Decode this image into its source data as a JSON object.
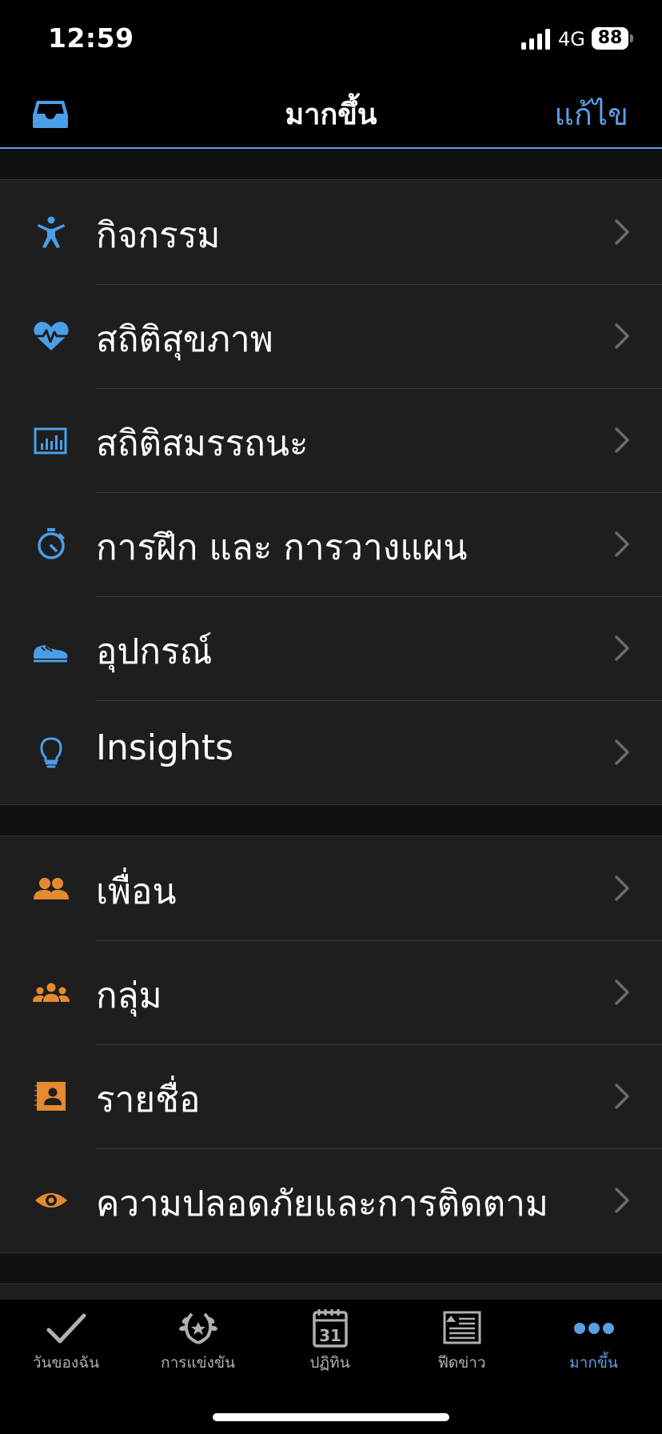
{
  "status_bar": {
    "time": "12:59",
    "network": "4G",
    "battery": "88"
  },
  "nav": {
    "title": "มากขึ้น",
    "edit_label": "แก้ไข",
    "inbox_icon": "inbox-icon"
  },
  "sections": [
    {
      "items": [
        {
          "label": "กิจกรรม",
          "icon": "activity-person-icon",
          "color": "#4a9fe8"
        },
        {
          "label": "สถิติสุขภาพ",
          "icon": "heart-rate-icon",
          "color": "#4a9fe8"
        },
        {
          "label": "สถิติสมรรถนะ",
          "icon": "performance-chart-icon",
          "color": "#4a9fe8"
        },
        {
          "label": "การฝึก และ การวางแผน",
          "icon": "stopwatch-icon",
          "color": "#4a9fe8"
        },
        {
          "label": "อุปกรณ์",
          "icon": "shoe-icon",
          "color": "#4a9fe8"
        },
        {
          "label": "Insights",
          "icon": "lightbulb-icon",
          "color": "#4a9fe8"
        }
      ]
    },
    {
      "items": [
        {
          "label": "เพื่อน",
          "icon": "friends-icon",
          "color": "#e38b2e"
        },
        {
          "label": "กลุ่ม",
          "icon": "groups-icon",
          "color": "#e38b2e"
        },
        {
          "label": "รายชื่อ",
          "icon": "contacts-book-icon",
          "color": "#e38b2e"
        },
        {
          "label": "ความปลอดภัยและการติดตาม",
          "icon": "eye-icon",
          "color": "#e38b2e"
        }
      ]
    }
  ],
  "tabs": [
    {
      "label": "วันของฉัน",
      "icon": "checkmark-icon",
      "active": false
    },
    {
      "label": "การแข่งขัน",
      "icon": "laurel-trophy-icon",
      "active": false
    },
    {
      "label": "ปฏิทิน",
      "icon": "calendar-icon",
      "calendar_day": "31",
      "active": false
    },
    {
      "label": "ฟีดข่าว",
      "icon": "newsfeed-icon",
      "active": false
    },
    {
      "label": "มากขึ้น",
      "icon": "more-dots-icon",
      "active": true
    }
  ],
  "colors": {
    "accent_blue": "#5b9ee6",
    "accent_orange": "#e38b2e",
    "row_background": "#1e1e1e"
  }
}
